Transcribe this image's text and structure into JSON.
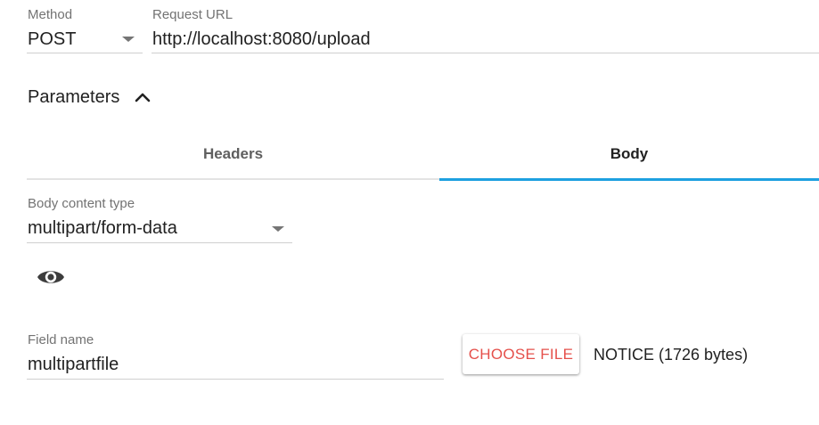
{
  "request": {
    "method_label": "Method",
    "method_value": "POST",
    "url_label": "Request URL",
    "url_value": "http://localhost:8080/upload"
  },
  "parameters": {
    "title": "Parameters",
    "toggle_icon": "chevron-up-icon"
  },
  "tabs": [
    {
      "label": "Headers",
      "active": false
    },
    {
      "label": "Body",
      "active": true
    }
  ],
  "body": {
    "content_type_label": "Body content type",
    "content_type_value": "multipart/form-data",
    "preview_icon": "eye-icon",
    "field_name_label": "Field name",
    "field_name_value": "multipartfile",
    "choose_file_label": "CHOOSE FILE",
    "file_info": "NOTICE (1726 bytes)"
  },
  "colors": {
    "accent": "#1ea0e0",
    "button_text": "#e5504b",
    "label": "#737373"
  }
}
